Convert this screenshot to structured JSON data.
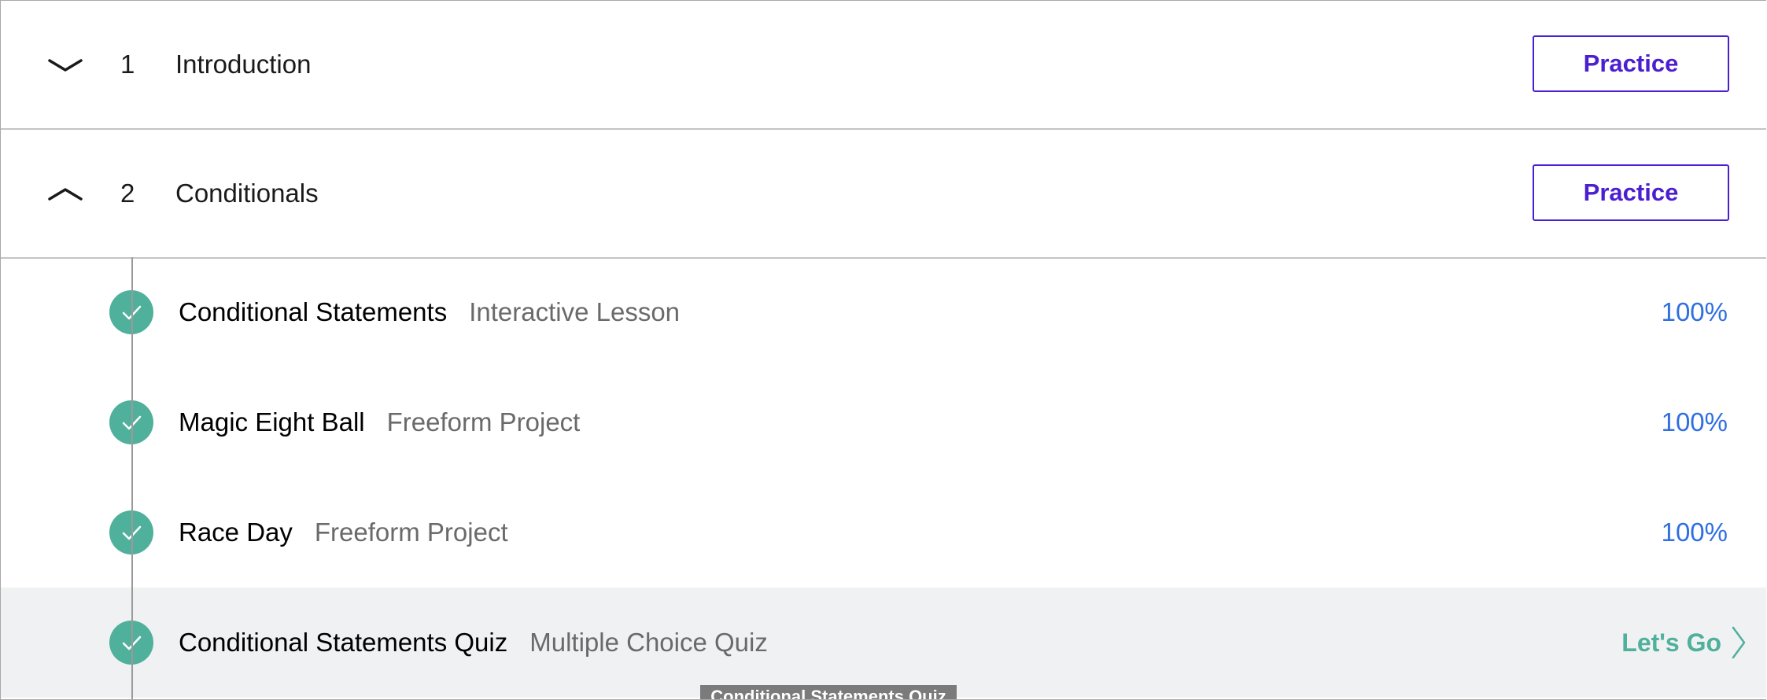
{
  "modules": [
    {
      "number": "1",
      "title": "Introduction",
      "practice_label": "Practice",
      "expanded": false,
      "chevron_icon": "chevron-down-icon"
    },
    {
      "number": "2",
      "title": "Conditionals",
      "practice_label": "Practice",
      "expanded": true,
      "chevron_icon": "chevron-up-icon"
    }
  ],
  "lessons": [
    {
      "title": "Conditional Statements",
      "type": "Interactive Lesson",
      "progress": "100%",
      "status_icon": "check-circle-icon"
    },
    {
      "title": "Magic Eight Ball",
      "type": "Freeform Project",
      "progress": "100%",
      "status_icon": "check-circle-icon"
    },
    {
      "title": "Race Day",
      "type": "Freeform Project",
      "progress": "100%",
      "status_icon": "check-circle-icon"
    },
    {
      "title": "Conditional Statements Quiz",
      "type": "Multiple Choice Quiz",
      "action_label": "Let's Go",
      "status_icon": "check-circle-icon",
      "action_icon": "chevron-right-icon"
    }
  ],
  "tooltip": {
    "text": "Conditional Statements Quiz"
  },
  "colors": {
    "accent_purple": "#4b1fd1",
    "check_green": "#4fb09b",
    "progress_blue": "#2f6fe0",
    "highlight_row": "#f0f1f3"
  }
}
